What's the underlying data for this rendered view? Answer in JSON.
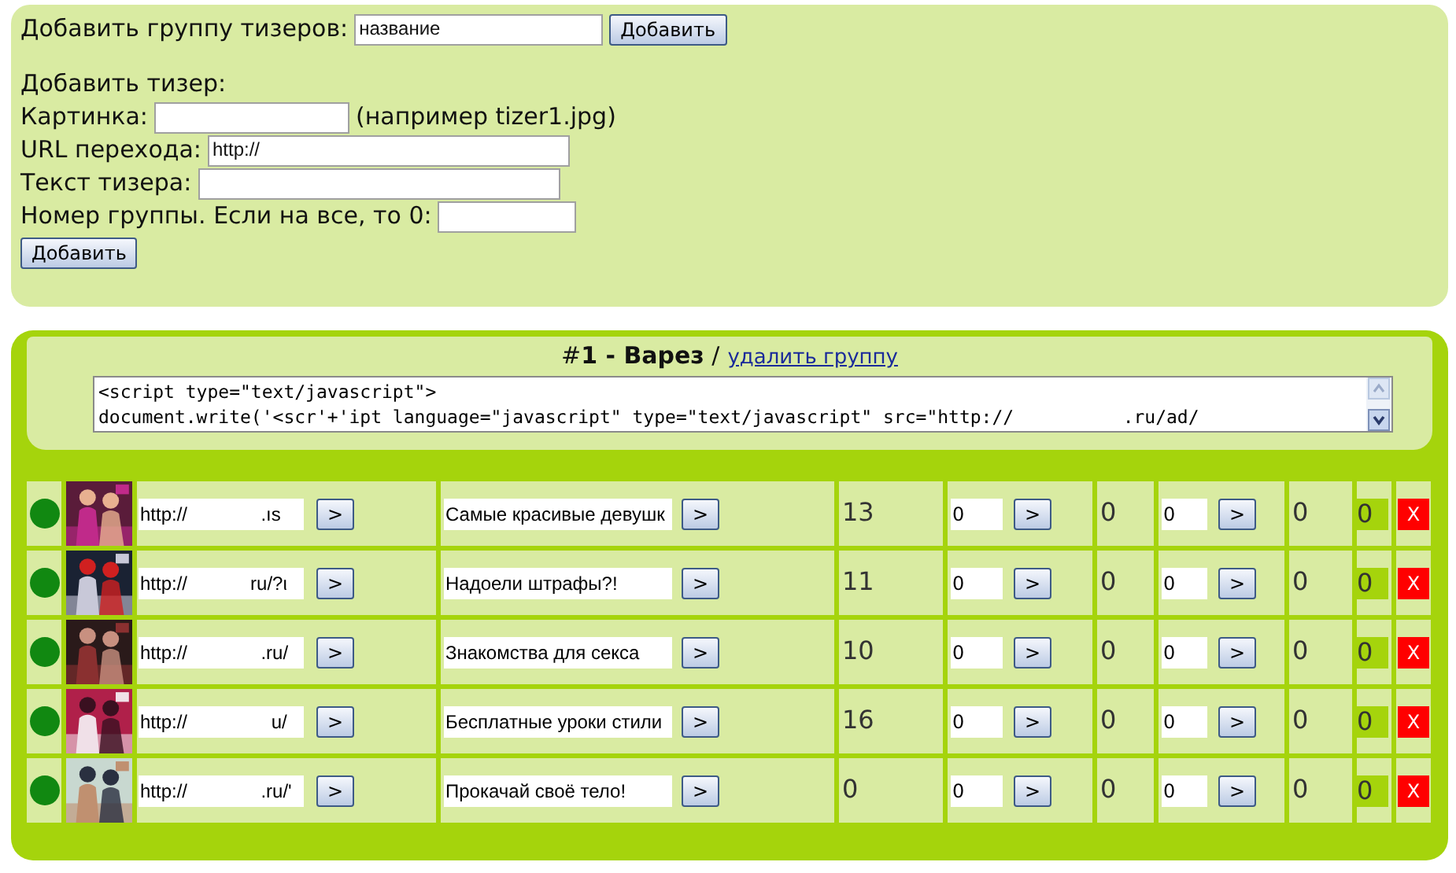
{
  "add_group": {
    "label": "Добавить группу тизеров:",
    "value": "название",
    "button": "Добавить"
  },
  "add_teaser": {
    "heading": "Добавить тизер:",
    "fields": [
      {
        "label": "Картинка:",
        "hint": "(например tizer1.jpg)"
      },
      {
        "label": "URL перехода:",
        "value": "http://"
      },
      {
        "label": "Текст тизера:"
      },
      {
        "label": "Номер группы. Если на все, то 0:"
      }
    ],
    "button": "Добавить"
  },
  "group": {
    "title": "#**1 - Варез** /",
    "delete_link": "удалить группу",
    "code_lines": [
      "<script type=\"text/javascript\">",
      "document.write('<scr'+'ipt language=\"javascript\" type=\"text/javascript\" src=\"http://          .ru/ad/"
    ]
  },
  "rows": [
    {
      "color": "#118811",
      "url": "http://              .ıs",
      "url_button": ">",
      "text": "Самые красивые девушк",
      "text_button": ">",
      "clicks": "13",
      "field_1": "0",
      "button_1": ">",
      "value_1": "0",
      "field_2": "0",
      "button_2": ">",
      "value_2": "0",
      "total": "0",
      "delete": "X"
    },
    {
      "color": "#118811",
      "url": "http://            ru/?ι",
      "url_button": ">",
      "text": "Надоели штрафы?!",
      "text_button": ">",
      "clicks": "11",
      "field_1": "0",
      "button_1": ">",
      "value_1": "0",
      "field_2": "0",
      "button_2": ">",
      "value_2": "0",
      "total": "0",
      "delete": "X"
    },
    {
      "color": "#118811",
      "url": "http://              .ru/",
      "url_button": ">",
      "text": "Знакомства для секса",
      "text_button": ">",
      "clicks": "10",
      "field_1": "0",
      "button_1": ">",
      "value_1": "0",
      "field_2": "0",
      "button_2": ">",
      "value_2": "0",
      "total": "0",
      "delete": "X"
    },
    {
      "color": "#118811",
      "url": "http://                u/",
      "url_button": ">",
      "text": "Бесплатные уроки стили",
      "text_button": ">",
      "clicks": "16",
      "field_1": "0",
      "button_1": ">",
      "value_1": "0",
      "field_2": "0",
      "button_2": ">",
      "value_2": "0",
      "total": "0",
      "delete": "X"
    },
    {
      "color": "#118811",
      "url": "http://              .ru/'",
      "url_button": ">",
      "text": "Прокачай своё тело!",
      "text_button": ">",
      "clicks": "0",
      "field_1": "0",
      "button_1": ">",
      "value_1": "0",
      "field_2": "0",
      "button_2": ">",
      "value_2": "0",
      "total": "0",
      "delete": "X"
    }
  ]
}
